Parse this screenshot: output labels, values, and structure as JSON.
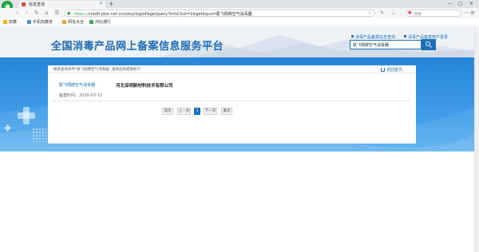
{
  "browser": {
    "tab_title": "信息查询",
    "url_protocol": "https://",
    "url_rest": "credit.jdzx.net.cn/xdcp/loginPage/query?infoClick=1&getInput=联飞翔牌空气消毒器",
    "search_placeholder": "搜索",
    "bookmarks": [
      "收藏",
      "手机收藏夹",
      "网址大全",
      "河北通行"
    ]
  },
  "site": {
    "title": "全国消毒产品网上备案信息服务平台",
    "links": [
      "消毒产品备案信息查询",
      "消毒产品备案用户登录"
    ],
    "search_value": "联飞翔牌空气消毒器"
  },
  "results": {
    "notice": "搜索查询条件\"联飞翔牌空气消毒器\",查询出的结果如下:",
    "back_label": "返回首页",
    "items": [
      {
        "product": "联飞翔牌空气消毒器",
        "company": "河北深玥新材料技术有限公司",
        "date_label": "备案时间：",
        "date": "2020-03-13"
      }
    ]
  },
  "pagination": {
    "first": "首页",
    "prev": "上一页",
    "current": "1",
    "next": "下一页",
    "last": "尾页"
  }
}
